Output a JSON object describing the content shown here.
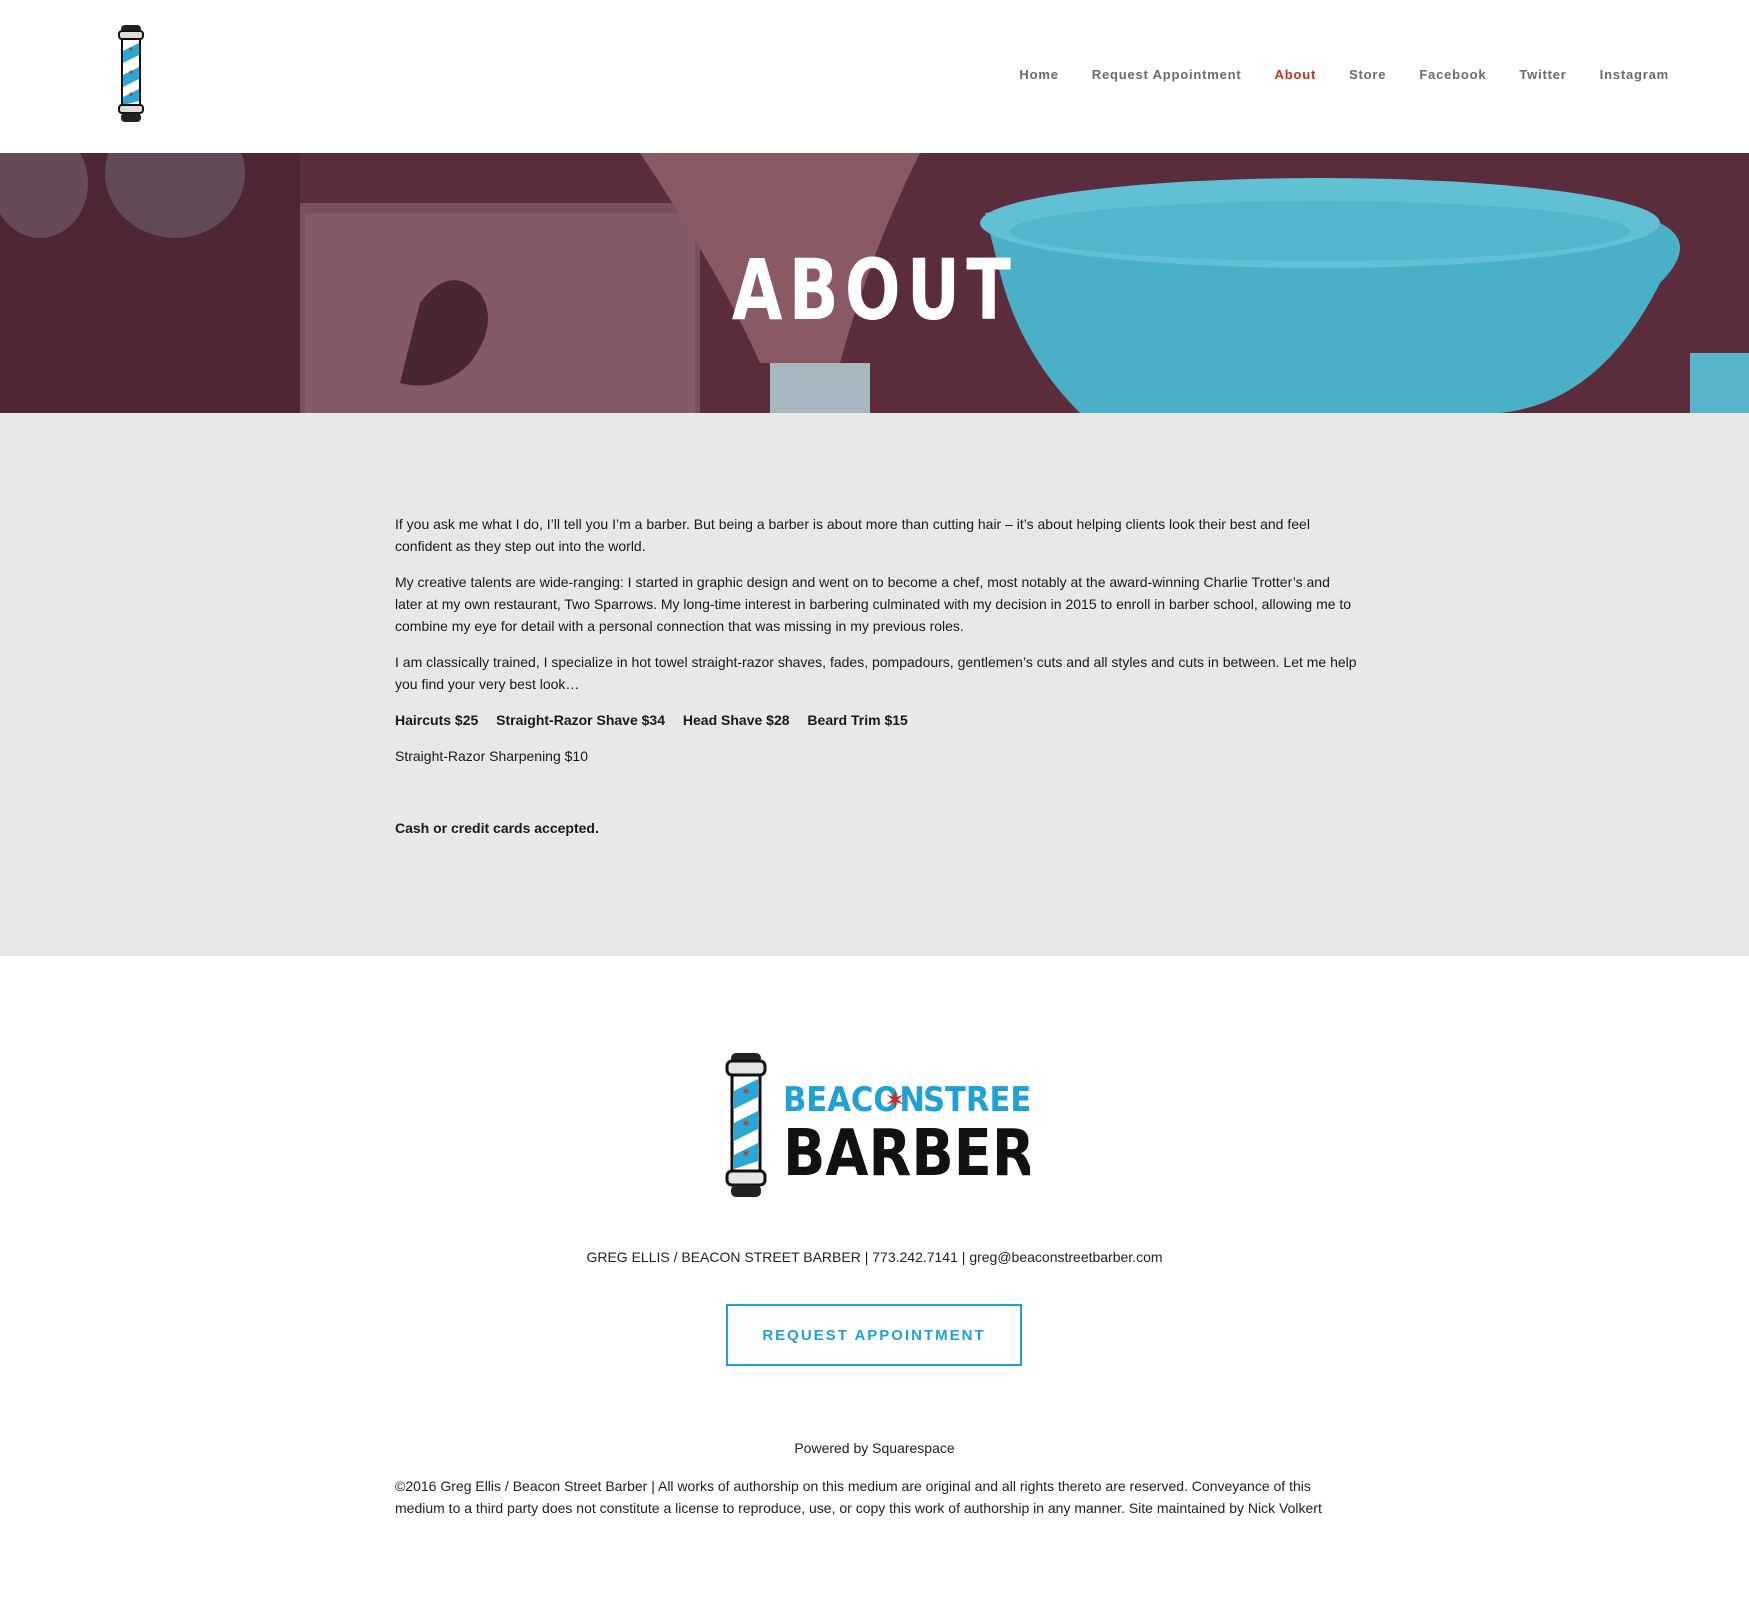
{
  "header": {
    "nav": [
      {
        "label": "Home"
      },
      {
        "label": "Request Appointment"
      },
      {
        "label": "About",
        "active": true
      },
      {
        "label": "Store"
      },
      {
        "label": "Facebook"
      },
      {
        "label": "Twitter"
      },
      {
        "label": "Instagram"
      }
    ]
  },
  "hero": {
    "title": "ABOUT"
  },
  "content": {
    "paragraphs": [
      "If you ask me what I do, I’ll tell you I’m a barber. But being a barber is about more than cutting hair – it’s about helping clients look their best and feel confident as they step out into the world.",
      "My creative talents are wide-ranging: I started in graphic design and went on to become a chef, most notably at the award-winning Charlie Trotter’s and later at my own restaurant, Two Sparrows. My long-time interest in barbering culminated with my decision in 2015 to enroll in barber school, allowing me to combine my eye for detail with a personal connection that was missing in my previous roles.",
      "I am classically trained, I specialize in hot towel straight-razor shaves, fades, pompadours, gentlemen’s cuts and all styles and cuts in between. Let me help you find your very best look…"
    ],
    "prices": [
      "Haircuts $25",
      "Straight-Razor Shave $34",
      "Head Shave $28",
      "Beard Trim $15"
    ],
    "sharpening": "Straight-Razor Sharpening $10",
    "payment": "Cash or credit cards accepted."
  },
  "footer": {
    "logo": {
      "line1a": "BEACON",
      "line1b": "STREET",
      "line2": "BARBER"
    },
    "contact_text": "GREG ELLIS / BEACON STREET BARBER | 773.242.7141 |",
    "contact_email": "greg@beaconstreetbarber.com",
    "button_label": "REQUEST APPOINTMENT",
    "powered_prefix": "Powered by",
    "powered_link": "Squarespace",
    "copyright_text": "©2016 Greg Ellis / Beacon Street Barber | All works of authorship on this medium are original and all rights thereto are reserved. Conveyance of this medium to a third party does not constitute a license to reproduce, use, or copy this work of authorship in any manner. Site maintained by",
    "copyright_link": "Nick Volkert"
  },
  "colors": {
    "accent_blue": "#1ea1d4",
    "active_red": "#c8321e",
    "hero_maroon": "#5a2c3b",
    "hero_teal": "#4ab0c8",
    "content_bg": "#e8e8e8"
  }
}
